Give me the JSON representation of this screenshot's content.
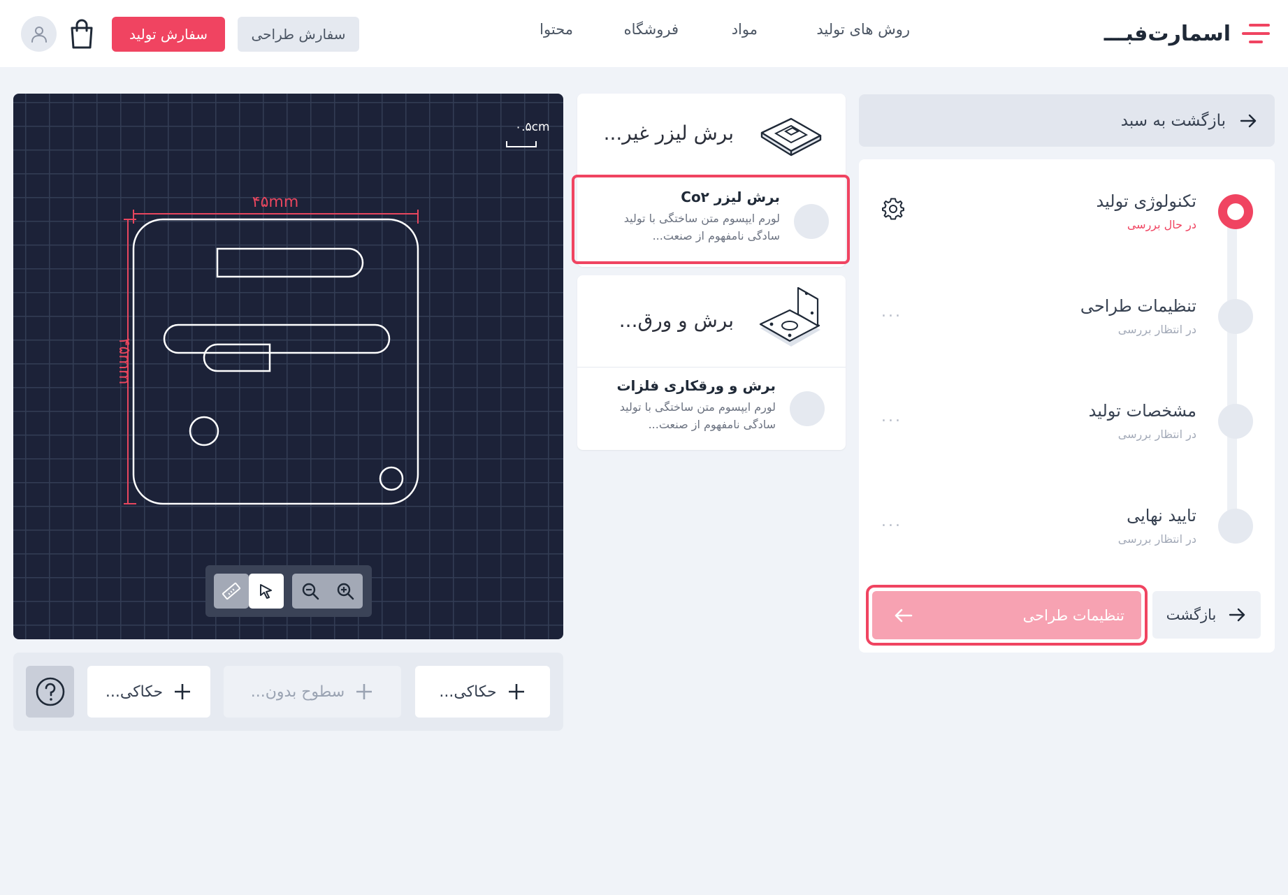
{
  "header": {
    "logo_text": "اسمارت‌فب",
    "logo_dash": "ـــ",
    "nav": [
      "روش های تولید",
      "مواد",
      "فروشگاه",
      "محتوا"
    ],
    "design_order_label": "سفارش طراحی",
    "production_order_label": "سفارش تولید",
    "accent_color": "#f04461"
  },
  "canvas": {
    "scale_label": "۰.۵cm",
    "width_label": "۴۵mm",
    "height_label": "۴۵mm",
    "tools": [
      "ruler-icon",
      "pointer-icon",
      "zoom-out-icon",
      "zoom-in-icon"
    ]
  },
  "bottom_bar": {
    "chips": [
      {
        "label": "حکاکی...",
        "disabled": false
      },
      {
        "label": "سطوح بدون...",
        "disabled": true
      },
      {
        "label": "حکاکی...",
        "disabled": false
      }
    ],
    "help_icon": "help-icon"
  },
  "technologies": [
    {
      "title": "برش لیزر غیر...",
      "option": {
        "title": "برش لیزر Co۲",
        "desc": "لورم ایپسوم متن ساختگی با تولید سادگی نامفهوم از صنعت...",
        "selected": true
      }
    },
    {
      "title": "برش و ورق...",
      "option": {
        "title": "برش و ورقکاری فلزات",
        "desc": "لورم ایپسوم متن ساختگی با تولید سادگی نامفهوم از صنعت...",
        "selected": false
      }
    }
  ],
  "steps_panel": {
    "back_to_cart": "بازگشت به سبد",
    "steps": [
      {
        "title": "تکنولوژی تولید",
        "status": "در حال بررسی",
        "active": true
      },
      {
        "title": "تنظیمات طراحی",
        "status": "در انتظار بررسی",
        "active": false
      },
      {
        "title": "مشخصات تولید",
        "status": "در انتظار بررسی",
        "active": false
      },
      {
        "title": "تایید نهایی",
        "status": "در انتظار بررسی",
        "active": false
      }
    ],
    "dots": "...",
    "back_label": "بازگشت",
    "next_label": "تنظیمات طراحی"
  }
}
